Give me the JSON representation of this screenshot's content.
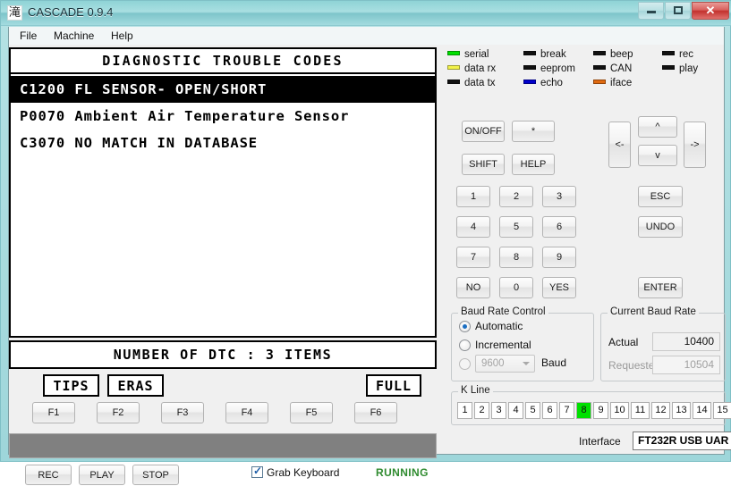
{
  "window": {
    "title": "CASCADE 0.9.4",
    "icon_glyph": "滝",
    "controls": {
      "minimize": "minimize-icon",
      "maximize": "maximize-icon",
      "close": "✕"
    }
  },
  "menubar": {
    "items": [
      {
        "label": "File"
      },
      {
        "label": "Machine"
      },
      {
        "label": "Help"
      }
    ]
  },
  "screen": {
    "title": "DIAGNOSTIC TROUBLE CODES",
    "rows": [
      {
        "text": "C1200 FL SENSOR- OPEN/SHORT",
        "selected": true
      },
      {
        "text": "P0070 Ambient Air Temperature Sensor",
        "selected": false
      },
      {
        "text": "C3070 NO MATCH IN DATABASE",
        "selected": false
      }
    ],
    "footer": "NUMBER OF DTC  :  3 ITEMS"
  },
  "softkeys": [
    {
      "id": "tips",
      "label": "TIPS"
    },
    {
      "id": "eras",
      "label": "ERAS"
    },
    {
      "id": "full",
      "label": "FULL"
    }
  ],
  "function_keys": [
    {
      "label": "F1"
    },
    {
      "label": "F2"
    },
    {
      "label": "F3"
    },
    {
      "label": "F4"
    },
    {
      "label": "F5"
    },
    {
      "label": "F6"
    }
  ],
  "transport": {
    "rec": "REC",
    "play": "PLAY",
    "stop": "STOP",
    "grab_keyboard_label": "Grab Keyboard",
    "grab_keyboard_checked": true,
    "status": "RUNNING",
    "status_color": "#2f8b2f"
  },
  "leds": [
    {
      "name": "serial",
      "label": "serial",
      "color": "#00e000"
    },
    {
      "name": "break",
      "label": "break",
      "color": "#111111"
    },
    {
      "name": "beep",
      "label": "beep",
      "color": "#111111"
    },
    {
      "name": "rec",
      "label": "rec",
      "color": "#111111"
    },
    {
      "name": "data-rx",
      "label": "data rx",
      "color": "#f2f24a"
    },
    {
      "name": "eeprom",
      "label": "eeprom",
      "color": "#111111"
    },
    {
      "name": "can",
      "label": "CAN",
      "color": "#111111"
    },
    {
      "name": "play",
      "label": "play",
      "color": "#111111"
    },
    {
      "name": "data-tx",
      "label": "data tx",
      "color": "#111111"
    },
    {
      "name": "echo",
      "label": "echo",
      "color": "#0000cc"
    },
    {
      "name": "iface",
      "label": "iface",
      "color": "#e06a10"
    }
  ],
  "keypad": {
    "onoff": "ON/OFF",
    "star": "*",
    "shift": "SHIFT",
    "help": "HELP",
    "k1": "1",
    "k2": "2",
    "k3": "3",
    "k4": "4",
    "k5": "5",
    "k6": "6",
    "k7": "7",
    "k8": "8",
    "k9": "9",
    "no": "NO",
    "k0": "0",
    "yes": "YES",
    "left": "<-",
    "up": "^",
    "down": "v",
    "right": "->",
    "esc": "ESC",
    "undo": "UNDO",
    "enter": "ENTER"
  },
  "baud_control": {
    "legend": "Baud Rate Control",
    "automatic_label": "Automatic",
    "automatic_selected": true,
    "incremental_label": "Incremental",
    "incremental_selected": false,
    "manual_selected": false,
    "manual_value": "9600",
    "manual_unit": "Baud"
  },
  "current_baud": {
    "legend": "Current Baud Rate",
    "actual_label": "Actual",
    "actual_value": "10400",
    "requested_label": "Requested",
    "requested_value": "10504"
  },
  "kline": {
    "legend": "K Line",
    "cells": [
      "1",
      "2",
      "3",
      "4",
      "5",
      "6",
      "7",
      "8",
      "9",
      "10",
      "11",
      "12",
      "13",
      "14",
      "15"
    ],
    "active": "8",
    "active_color": "#00e000"
  },
  "interface": {
    "label": "Interface",
    "value": "FT232R USB UAR"
  }
}
